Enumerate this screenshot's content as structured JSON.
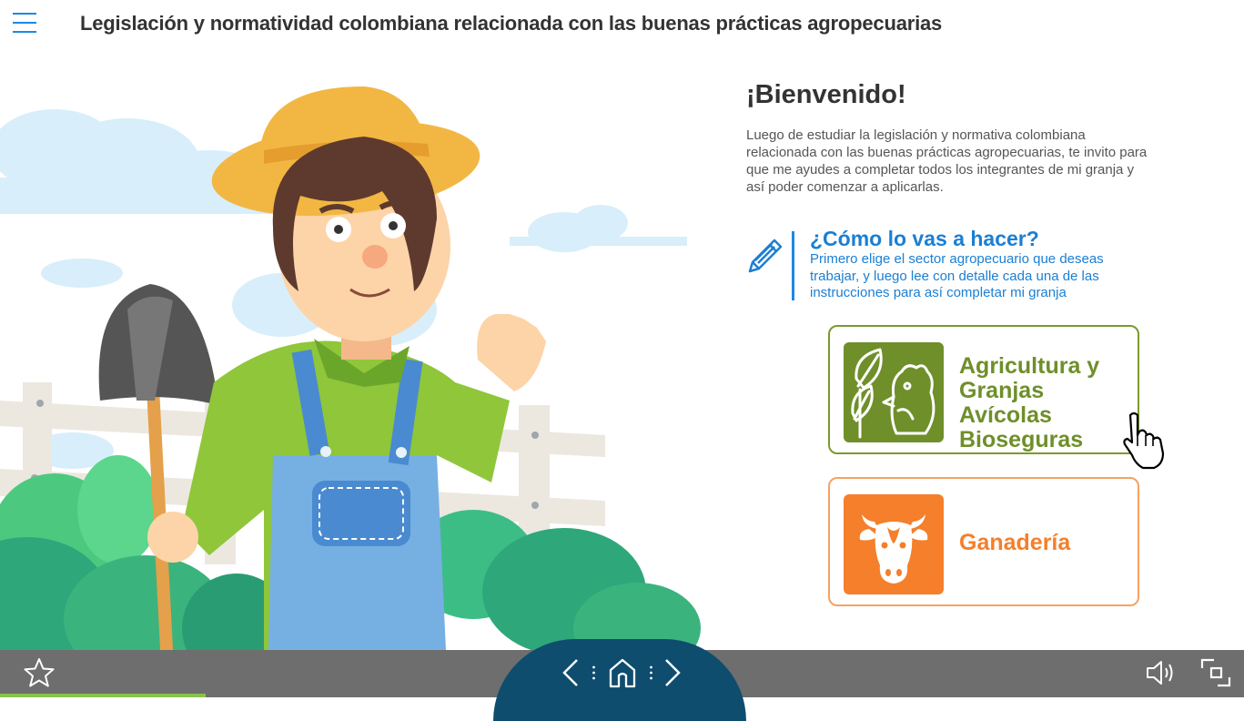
{
  "header": {
    "title": "Legislación y normatividad colombiana relacionada con las buenas prácticas agropecuarias"
  },
  "welcome": {
    "heading": "¡Bienvenido!",
    "text": "Luego de estudiar la legislación y normativa colombiana relacionada con las buenas prácticas agropecuarias, te invito para que me ayudes a completar todos los integrantes de mi granja y así poder comenzar a aplicarlas."
  },
  "how": {
    "title": "¿Cómo lo vas a hacer?",
    "text": "Primero elige el sector agropecuario que deseas trabajar, y luego lee con detalle cada una de las instrucciones para así completar mi granja",
    "icon": "pencil-icon"
  },
  "options": [
    {
      "label": "Agricultura y Granjas Avícolas Bioseguras",
      "icon": "leaf-rooster-icon",
      "color": "#6f8f2a"
    },
    {
      "label": "Ganadería",
      "icon": "cow-icon",
      "color": "#f57f2a"
    }
  ],
  "toolbar": {
    "favorite_icon": "star-icon",
    "prev_icon": "chevron-left-icon",
    "home_icon": "home-icon",
    "next_icon": "chevron-right-icon",
    "sound_icon": "speaker-icon",
    "fullscreen_icon": "fullscreen-icon",
    "progress": 0.165
  },
  "colors": {
    "accent_blue": "#1e88e5",
    "agri_green": "#6f8f2a",
    "ganaderia_orange": "#f57f2a",
    "nav_dome": "#0e4d6e",
    "progress": "#8bc34a"
  }
}
